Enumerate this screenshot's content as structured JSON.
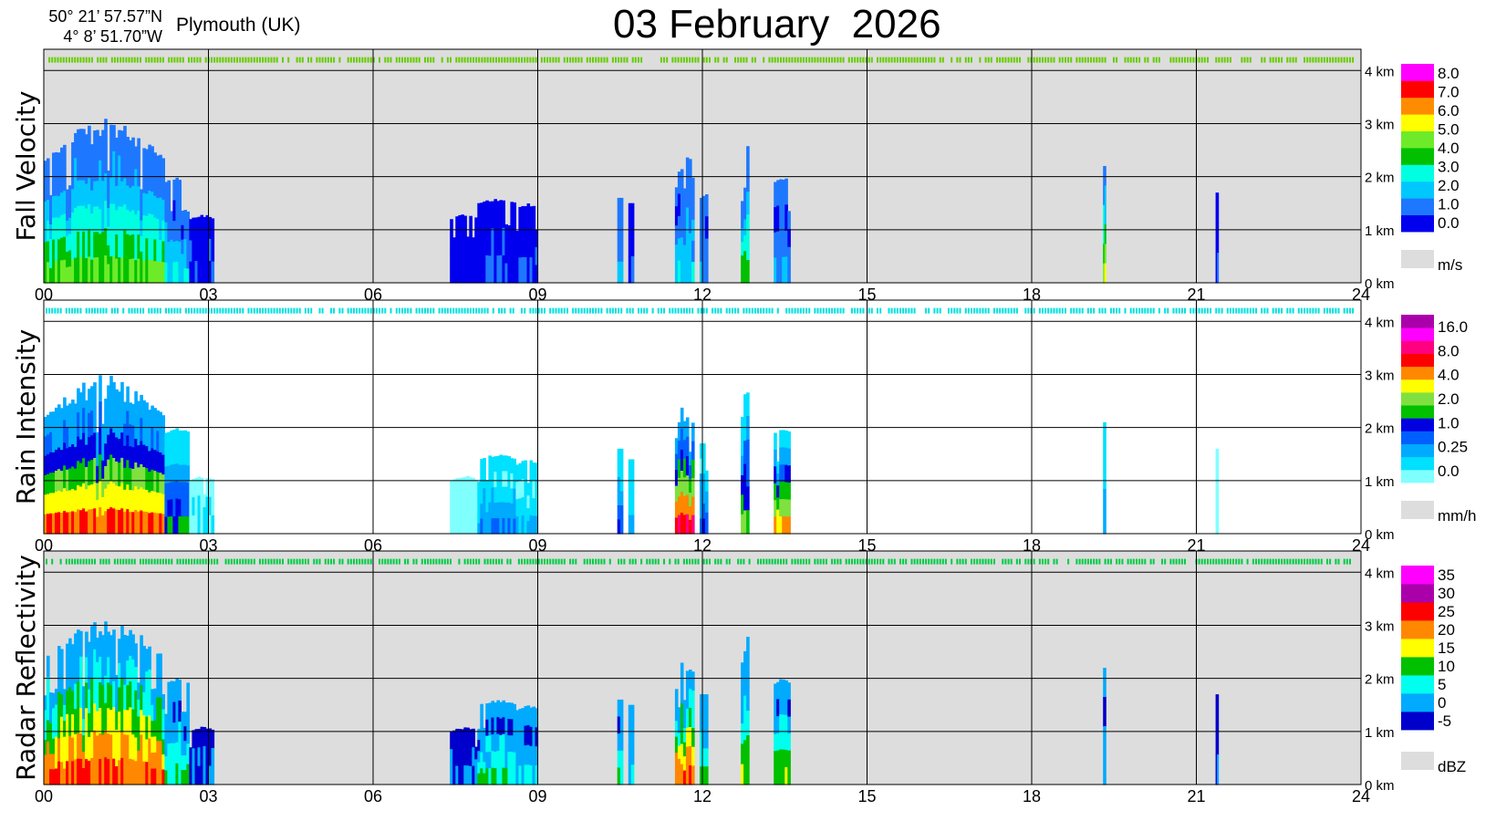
{
  "header": {
    "lat": "50° 21’ 57.57”N",
    "lon": "4°  8’ 51.70”W",
    "location": "Plymouth (UK)",
    "title": "03 February  2026"
  },
  "chart_data": [
    {
      "type": "heatmap",
      "ylabel": "Fall Velocity",
      "unit": "m/s",
      "background": "#dddddd",
      "xlim": [
        0,
        24
      ],
      "ylim_km": [
        0,
        4.4
      ],
      "x_ticks": [
        "00",
        "03",
        "06",
        "09",
        "12",
        "15",
        "18",
        "21",
        "24"
      ],
      "y_ticks": [
        "0 km",
        "1 km",
        "2 km",
        "3 km",
        "4 km"
      ],
      "scale_labels": [
        "0.0",
        "1.0",
        "2.0",
        "3.0",
        "4.0",
        "5.0",
        "6.0",
        "7.0",
        "8.0"
      ],
      "scale_colors": [
        "#0000ee",
        "#1e78ff",
        "#00c8ff",
        "#00ffe0",
        "#00c000",
        "#6eeb28",
        "#ffff00",
        "#ff8c00",
        "#ff0000",
        "#ff00ff"
      ],
      "top_line_color": "#66cc00",
      "echoes": [
        {
          "start": 0.0,
          "end": 2.2,
          "top": 2.3,
          "peak": 3.1,
          "level": 5
        },
        {
          "start": 2.2,
          "end": 2.65,
          "top": 1.9,
          "peak": 2.0,
          "level": 3
        },
        {
          "start": 2.65,
          "end": 3.1,
          "top": 1.2,
          "peak": 1.3,
          "level": 1
        },
        {
          "start": 7.4,
          "end": 7.9,
          "top": 1.2,
          "peak": 1.3,
          "level": 0
        },
        {
          "start": 7.9,
          "end": 8.6,
          "top": 1.5,
          "peak": 1.6,
          "level": 1
        },
        {
          "start": 8.6,
          "end": 9.0,
          "top": 1.4,
          "peak": 1.5,
          "level": 1
        },
        {
          "start": 10.45,
          "end": 10.55,
          "top": 1.6,
          "peak": 1.6,
          "level": 2
        },
        {
          "start": 10.65,
          "end": 10.75,
          "top": 1.5,
          "peak": 1.5,
          "level": 1
        },
        {
          "start": 11.5,
          "end": 11.85,
          "top": 1.8,
          "peak": 2.7,
          "level": 3
        },
        {
          "start": 11.95,
          "end": 12.1,
          "top": 1.6,
          "peak": 1.7,
          "level": 2
        },
        {
          "start": 12.7,
          "end": 12.85,
          "top": 2.2,
          "peak": 2.8,
          "level": 5
        },
        {
          "start": 13.3,
          "end": 13.6,
          "top": 1.9,
          "peak": 2.0,
          "level": 2
        },
        {
          "start": 19.3,
          "end": 19.35,
          "top": 2.2,
          "peak": 2.2,
          "level": 6
        },
        {
          "start": 21.35,
          "end": 21.4,
          "top": 1.7,
          "peak": 1.7,
          "level": 1
        }
      ]
    },
    {
      "type": "heatmap",
      "ylabel": "Rain Intensity",
      "unit": "mm/h",
      "background": "#ffffff",
      "xlim": [
        0,
        24
      ],
      "ylim_km": [
        0,
        4.4
      ],
      "x_ticks": [
        "00",
        "03",
        "06",
        "09",
        "12",
        "15",
        "18",
        "21",
        "24"
      ],
      "y_ticks": [
        "0 km",
        "1 km",
        "2 km",
        "3 km",
        "4 km"
      ],
      "scale_labels": [
        "0.0",
        "0.25",
        "1.0",
        "2.0",
        "4.0",
        "8.0",
        "16.0"
      ],
      "scale_colors": [
        "#80ffff",
        "#00e0ff",
        "#00aaff",
        "#0060ff",
        "#0000e0",
        "#00c000",
        "#80e040",
        "#ffff00",
        "#ff8800",
        "#ff0000",
        "#ff0080",
        "#ff00ff",
        "#aa00aa"
      ],
      "top_line_color": "#00e0e0",
      "echoes": [
        {
          "start": 0.0,
          "end": 2.2,
          "top": 2.2,
          "peak": 3.0,
          "level": 9
        },
        {
          "start": 2.2,
          "end": 2.65,
          "top": 1.9,
          "peak": 2.0,
          "level": 5
        },
        {
          "start": 2.65,
          "end": 3.1,
          "top": 1.0,
          "peak": 1.1,
          "level": 1
        },
        {
          "start": 7.4,
          "end": 7.9,
          "top": 1.0,
          "peak": 1.1,
          "level": 0
        },
        {
          "start": 7.9,
          "end": 8.6,
          "top": 1.4,
          "peak": 1.5,
          "level": 3
        },
        {
          "start": 8.6,
          "end": 9.0,
          "top": 1.3,
          "peak": 1.4,
          "level": 2
        },
        {
          "start": 10.45,
          "end": 10.55,
          "top": 1.6,
          "peak": 1.6,
          "level": 4
        },
        {
          "start": 10.65,
          "end": 10.75,
          "top": 1.4,
          "peak": 1.4,
          "level": 2
        },
        {
          "start": 11.5,
          "end": 11.85,
          "top": 1.8,
          "peak": 2.6,
          "level": 10
        },
        {
          "start": 11.95,
          "end": 12.1,
          "top": 1.7,
          "peak": 1.7,
          "level": 4
        },
        {
          "start": 12.7,
          "end": 12.85,
          "top": 2.2,
          "peak": 2.8,
          "level": 6
        },
        {
          "start": 13.3,
          "end": 13.6,
          "top": 1.9,
          "peak": 2.0,
          "level": 8
        },
        {
          "start": 19.3,
          "end": 19.35,
          "top": 2.1,
          "peak": 2.1,
          "level": 3
        },
        {
          "start": 21.35,
          "end": 21.4,
          "top": 1.6,
          "peak": 1.6,
          "level": 1
        }
      ]
    },
    {
      "type": "heatmap",
      "ylabel": "Radar Reflectivity",
      "unit": "dBZ",
      "background": "#dddddd",
      "xlim": [
        0,
        24
      ],
      "ylim_km": [
        0,
        4.4
      ],
      "x_ticks": [
        "00",
        "03",
        "06",
        "09",
        "12",
        "15",
        "18",
        "21",
        "24"
      ],
      "y_ticks": [
        "0 km",
        "1 km",
        "2 km",
        "3 km",
        "4 km"
      ],
      "scale_labels": [
        "-5",
        "0",
        "5",
        "10",
        "15",
        "20",
        "25",
        "30",
        "35"
      ],
      "scale_colors": [
        "#0000cc",
        "#00aaff",
        "#00ffee",
        "#00c000",
        "#ffff00",
        "#ff8800",
        "#ff0000",
        "#aa00aa",
        "#ff00ff"
      ],
      "top_line_color": "#00cc44",
      "echoes": [
        {
          "start": 0.0,
          "end": 2.2,
          "top": 2.4,
          "peak": 3.1,
          "level": 6
        },
        {
          "start": 2.2,
          "end": 2.65,
          "top": 1.9,
          "peak": 2.0,
          "level": 3
        },
        {
          "start": 2.65,
          "end": 3.1,
          "top": 1.0,
          "peak": 1.1,
          "level": 1
        },
        {
          "start": 7.4,
          "end": 7.9,
          "top": 1.0,
          "peak": 1.1,
          "level": 1
        },
        {
          "start": 7.9,
          "end": 8.6,
          "top": 1.5,
          "peak": 1.6,
          "level": 3
        },
        {
          "start": 8.6,
          "end": 9.0,
          "top": 1.4,
          "peak": 1.5,
          "level": 2
        },
        {
          "start": 10.45,
          "end": 10.55,
          "top": 1.6,
          "peak": 1.6,
          "level": 3
        },
        {
          "start": 10.65,
          "end": 10.75,
          "top": 1.5,
          "peak": 1.5,
          "level": 2
        },
        {
          "start": 11.5,
          "end": 11.85,
          "top": 1.8,
          "peak": 2.6,
          "level": 6
        },
        {
          "start": 11.95,
          "end": 12.1,
          "top": 1.7,
          "peak": 1.7,
          "level": 3
        },
        {
          "start": 12.7,
          "end": 12.85,
          "top": 2.3,
          "peak": 2.9,
          "level": 4
        },
        {
          "start": 13.3,
          "end": 13.6,
          "top": 1.9,
          "peak": 2.0,
          "level": 4
        },
        {
          "start": 19.3,
          "end": 19.35,
          "top": 2.2,
          "peak": 2.2,
          "level": 2
        },
        {
          "start": 21.35,
          "end": 21.4,
          "top": 1.7,
          "peak": 1.7,
          "level": 1
        }
      ]
    }
  ]
}
